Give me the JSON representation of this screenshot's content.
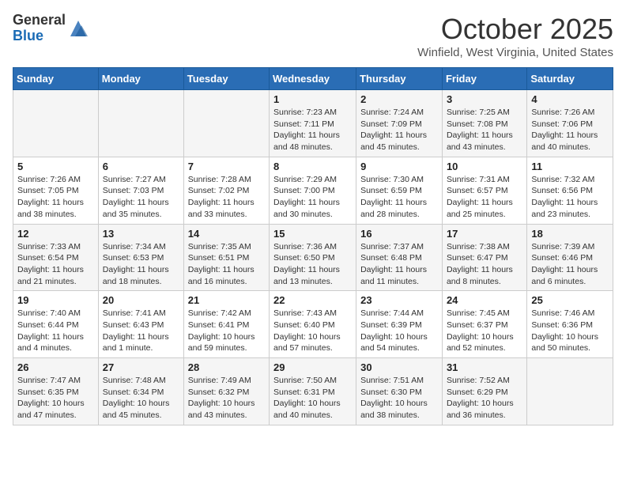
{
  "logo": {
    "general": "General",
    "blue": "Blue"
  },
  "header": {
    "month": "October 2025",
    "location": "Winfield, West Virginia, United States"
  },
  "days_of_week": [
    "Sunday",
    "Monday",
    "Tuesday",
    "Wednesday",
    "Thursday",
    "Friday",
    "Saturday"
  ],
  "weeks": [
    [
      {
        "day": "",
        "info": ""
      },
      {
        "day": "",
        "info": ""
      },
      {
        "day": "",
        "info": ""
      },
      {
        "day": "1",
        "info": "Sunrise: 7:23 AM\nSunset: 7:11 PM\nDaylight: 11 hours and 48 minutes."
      },
      {
        "day": "2",
        "info": "Sunrise: 7:24 AM\nSunset: 7:09 PM\nDaylight: 11 hours and 45 minutes."
      },
      {
        "day": "3",
        "info": "Sunrise: 7:25 AM\nSunset: 7:08 PM\nDaylight: 11 hours and 43 minutes."
      },
      {
        "day": "4",
        "info": "Sunrise: 7:26 AM\nSunset: 7:06 PM\nDaylight: 11 hours and 40 minutes."
      }
    ],
    [
      {
        "day": "5",
        "info": "Sunrise: 7:26 AM\nSunset: 7:05 PM\nDaylight: 11 hours and 38 minutes."
      },
      {
        "day": "6",
        "info": "Sunrise: 7:27 AM\nSunset: 7:03 PM\nDaylight: 11 hours and 35 minutes."
      },
      {
        "day": "7",
        "info": "Sunrise: 7:28 AM\nSunset: 7:02 PM\nDaylight: 11 hours and 33 minutes."
      },
      {
        "day": "8",
        "info": "Sunrise: 7:29 AM\nSunset: 7:00 PM\nDaylight: 11 hours and 30 minutes."
      },
      {
        "day": "9",
        "info": "Sunrise: 7:30 AM\nSunset: 6:59 PM\nDaylight: 11 hours and 28 minutes."
      },
      {
        "day": "10",
        "info": "Sunrise: 7:31 AM\nSunset: 6:57 PM\nDaylight: 11 hours and 25 minutes."
      },
      {
        "day": "11",
        "info": "Sunrise: 7:32 AM\nSunset: 6:56 PM\nDaylight: 11 hours and 23 minutes."
      }
    ],
    [
      {
        "day": "12",
        "info": "Sunrise: 7:33 AM\nSunset: 6:54 PM\nDaylight: 11 hours and 21 minutes."
      },
      {
        "day": "13",
        "info": "Sunrise: 7:34 AM\nSunset: 6:53 PM\nDaylight: 11 hours and 18 minutes."
      },
      {
        "day": "14",
        "info": "Sunrise: 7:35 AM\nSunset: 6:51 PM\nDaylight: 11 hours and 16 minutes."
      },
      {
        "day": "15",
        "info": "Sunrise: 7:36 AM\nSunset: 6:50 PM\nDaylight: 11 hours and 13 minutes."
      },
      {
        "day": "16",
        "info": "Sunrise: 7:37 AM\nSunset: 6:48 PM\nDaylight: 11 hours and 11 minutes."
      },
      {
        "day": "17",
        "info": "Sunrise: 7:38 AM\nSunset: 6:47 PM\nDaylight: 11 hours and 8 minutes."
      },
      {
        "day": "18",
        "info": "Sunrise: 7:39 AM\nSunset: 6:46 PM\nDaylight: 11 hours and 6 minutes."
      }
    ],
    [
      {
        "day": "19",
        "info": "Sunrise: 7:40 AM\nSunset: 6:44 PM\nDaylight: 11 hours and 4 minutes."
      },
      {
        "day": "20",
        "info": "Sunrise: 7:41 AM\nSunset: 6:43 PM\nDaylight: 11 hours and 1 minute."
      },
      {
        "day": "21",
        "info": "Sunrise: 7:42 AM\nSunset: 6:41 PM\nDaylight: 10 hours and 59 minutes."
      },
      {
        "day": "22",
        "info": "Sunrise: 7:43 AM\nSunset: 6:40 PM\nDaylight: 10 hours and 57 minutes."
      },
      {
        "day": "23",
        "info": "Sunrise: 7:44 AM\nSunset: 6:39 PM\nDaylight: 10 hours and 54 minutes."
      },
      {
        "day": "24",
        "info": "Sunrise: 7:45 AM\nSunset: 6:37 PM\nDaylight: 10 hours and 52 minutes."
      },
      {
        "day": "25",
        "info": "Sunrise: 7:46 AM\nSunset: 6:36 PM\nDaylight: 10 hours and 50 minutes."
      }
    ],
    [
      {
        "day": "26",
        "info": "Sunrise: 7:47 AM\nSunset: 6:35 PM\nDaylight: 10 hours and 47 minutes."
      },
      {
        "day": "27",
        "info": "Sunrise: 7:48 AM\nSunset: 6:34 PM\nDaylight: 10 hours and 45 minutes."
      },
      {
        "day": "28",
        "info": "Sunrise: 7:49 AM\nSunset: 6:32 PM\nDaylight: 10 hours and 43 minutes."
      },
      {
        "day": "29",
        "info": "Sunrise: 7:50 AM\nSunset: 6:31 PM\nDaylight: 10 hours and 40 minutes."
      },
      {
        "day": "30",
        "info": "Sunrise: 7:51 AM\nSunset: 6:30 PM\nDaylight: 10 hours and 38 minutes."
      },
      {
        "day": "31",
        "info": "Sunrise: 7:52 AM\nSunset: 6:29 PM\nDaylight: 10 hours and 36 minutes."
      },
      {
        "day": "",
        "info": ""
      }
    ]
  ]
}
